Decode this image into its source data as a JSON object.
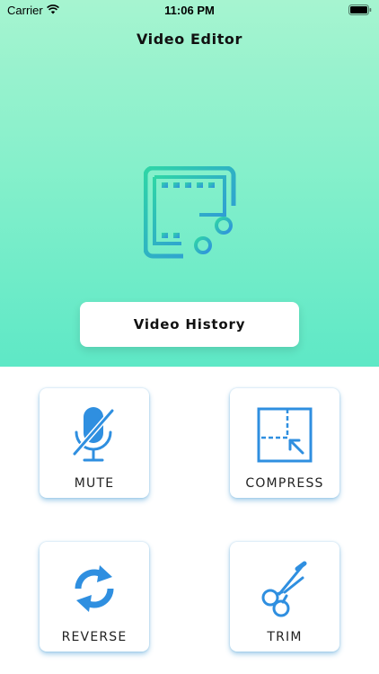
{
  "status_bar": {
    "carrier": "Carrier",
    "time": "11:06 PM",
    "wifi_icon": "wifi-icon",
    "battery_icon": "battery-icon"
  },
  "header": {
    "title": "Video Editor"
  },
  "hero": {
    "logo_icon": "film-scissors-icon",
    "history_button_label": "Video History",
    "gradient_colors": [
      "#a6f4d0",
      "#5ee8c6"
    ]
  },
  "tools": [
    {
      "label": "MUTE",
      "icon": "mic-off-icon"
    },
    {
      "label": "COMPRESS",
      "icon": "compress-icon"
    },
    {
      "label": "REVERSE",
      "icon": "reverse-icon"
    },
    {
      "label": "TRIM",
      "icon": "scissors-icon"
    }
  ],
  "colors": {
    "accent_blue": "#2f8fe0",
    "logo_gradient": [
      "#2fd6a6",
      "#2f8fe0"
    ]
  }
}
